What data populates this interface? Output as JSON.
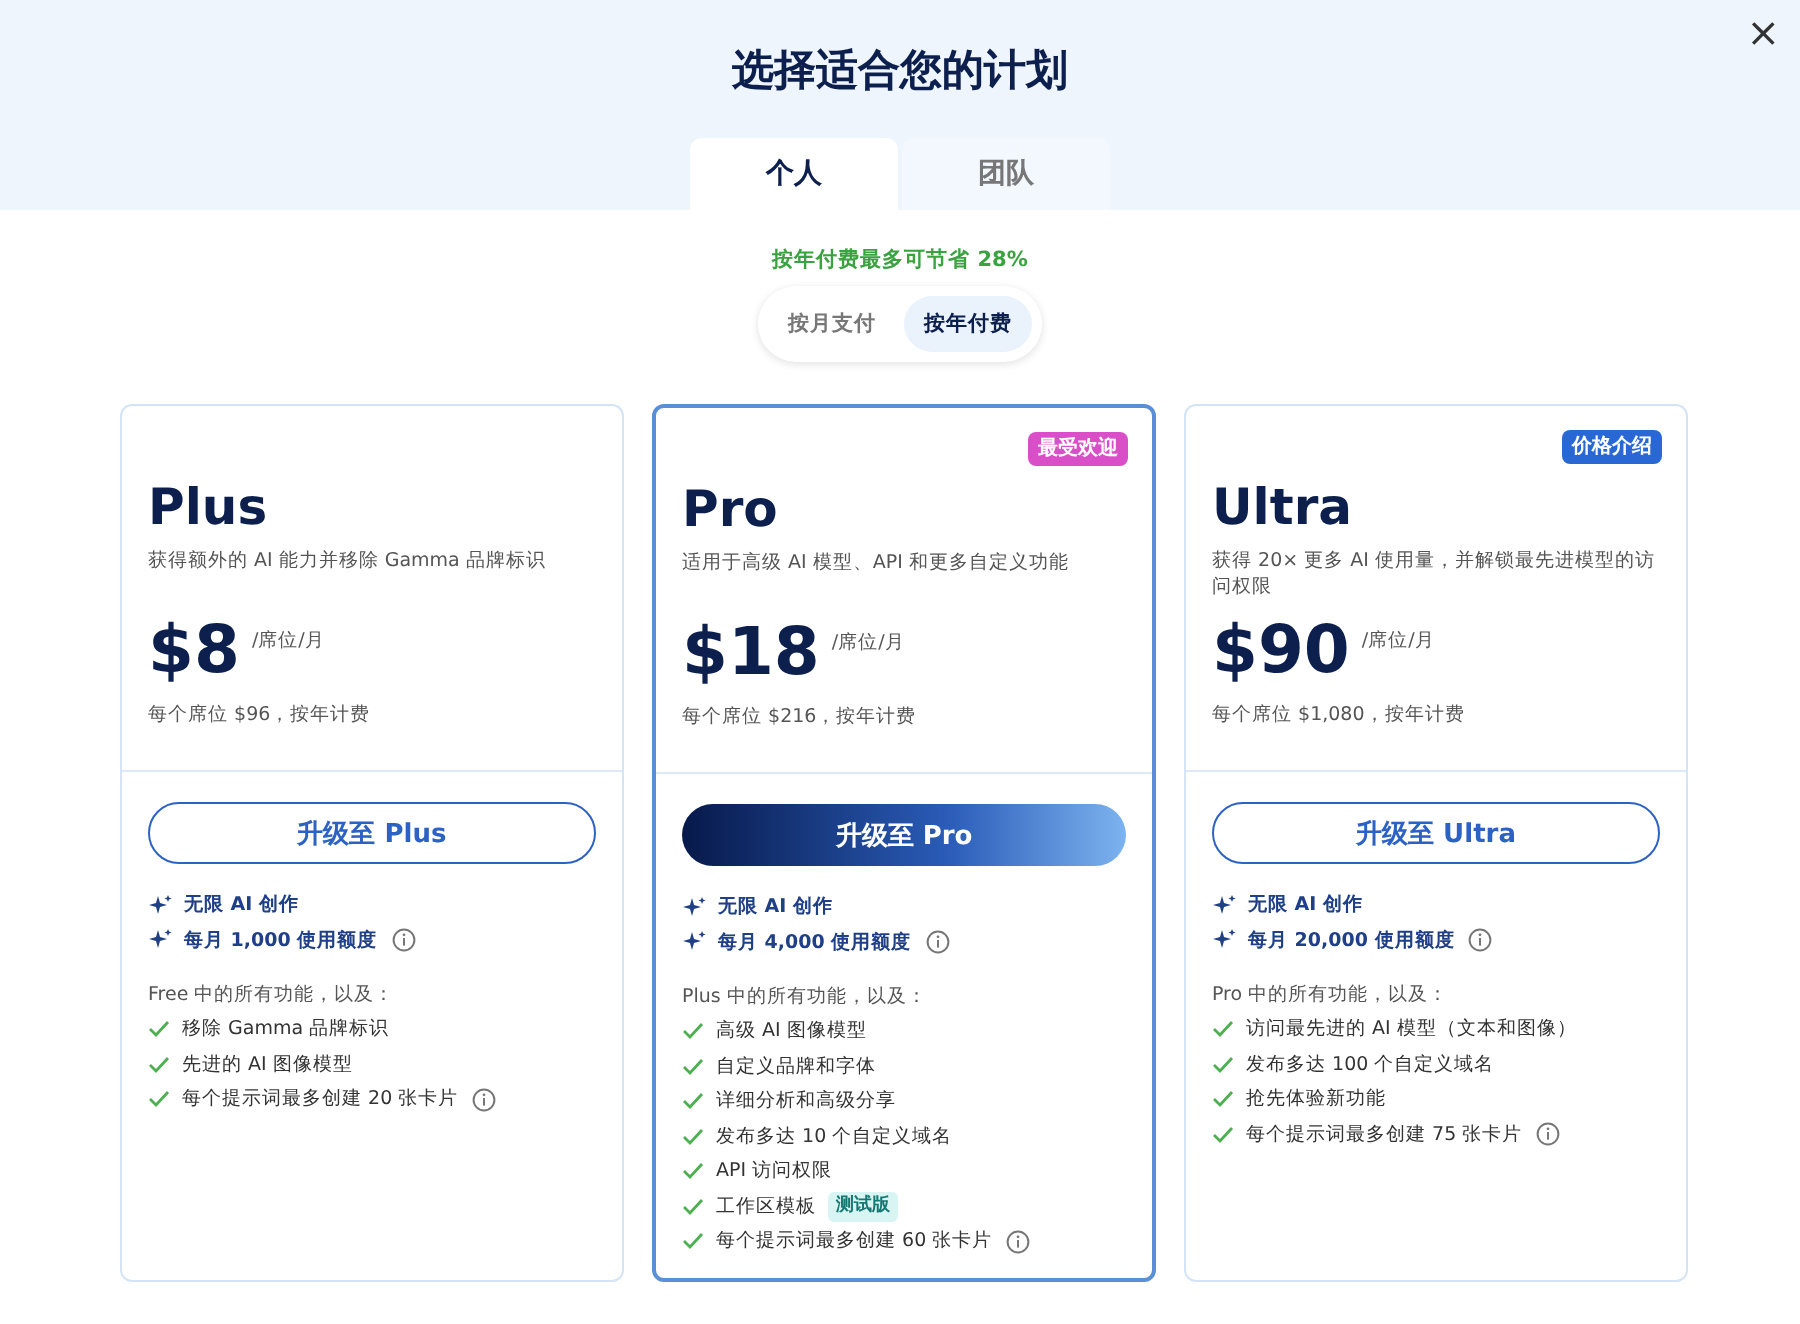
{
  "dialog": {
    "title": "选择适合您的计划",
    "close": "×"
  },
  "tabs": [
    {
      "label": "个人",
      "selected": true
    },
    {
      "label": "团队",
      "selected": false
    }
  ],
  "savings_note": "按年付费最多可节省 28%",
  "billing": [
    {
      "label": "按月支付",
      "selected": false
    },
    {
      "label": "按年付费",
      "selected": true
    }
  ],
  "plans": [
    {
      "name": "Plus",
      "highlighted": false,
      "description": "获得额外的 AI 能力并移除 Gamma 品牌标识",
      "price": "$8",
      "unit": "/席位/月",
      "billing_note": "每个席位 $96，按年计费",
      "button": "升级至 Plus",
      "credits": [
        {
          "text": "无限 AI 创作",
          "info": false
        },
        {
          "text": "每月 1,000 使用额度",
          "info": true
        }
      ],
      "features_heading": "Free 中的所有功能，以及：",
      "features": [
        {
          "text": "移除 Gamma 品牌标识",
          "info": false
        },
        {
          "text": "先进的 AI 图像模型",
          "info": false
        },
        {
          "text": "每个提示词最多创建 20 张卡片",
          "info": true
        }
      ]
    },
    {
      "name": "Pro",
      "highlighted": true,
      "badge": {
        "text": "最受欢迎",
        "color": "#d94fc8"
      },
      "description": "适用于高级 AI 模型、API 和更多自定义功能",
      "price": "$18",
      "unit": "/席位/月",
      "billing_note": "每个席位 $216，按年计费",
      "button": "升级至 Pro",
      "credits": [
        {
          "text": "无限 AI 创作",
          "info": false
        },
        {
          "text": "每月 4,000 使用额度",
          "info": true
        }
      ],
      "features_heading": "Plus 中的所有功能，以及：",
      "features": [
        {
          "text": "高级 AI 图像模型",
          "info": false
        },
        {
          "text": "自定义品牌和字体",
          "info": false
        },
        {
          "text": "详细分析和高级分享",
          "info": false
        },
        {
          "text": "发布多达 10 个自定义域名",
          "info": false
        },
        {
          "text": "API 访问权限",
          "info": false
        },
        {
          "text": "工作区模板",
          "info": false,
          "tag": "测试版"
        },
        {
          "text": "每个提示词最多创建 60 张卡片",
          "info": true
        }
      ]
    },
    {
      "name": "Ultra",
      "highlighted": false,
      "badge": {
        "text": "价格介绍",
        "color": "#2968d4"
      },
      "description": "获得 20× 更多 AI 使用量，并解锁最先进模型的访问权限",
      "price": "$90",
      "unit": "/席位/月",
      "billing_note": "每个席位 $1,080，按年计费",
      "button": "升级至 Ultra",
      "credits": [
        {
          "text": "无限 AI 创作",
          "info": false
        },
        {
          "text": "每月 20,000 使用额度",
          "info": true
        }
      ],
      "features_heading": "Pro 中的所有功能，以及：",
      "features": [
        {
          "text": "访问最先进的 AI 模型（文本和图像）",
          "info": false
        },
        {
          "text": "发布多达 100 个自定义域名",
          "info": false
        },
        {
          "text": "抢先体验新功能",
          "info": false
        },
        {
          "text": "每个提示词最多创建 75 张卡片",
          "info": true
        }
      ]
    }
  ]
}
